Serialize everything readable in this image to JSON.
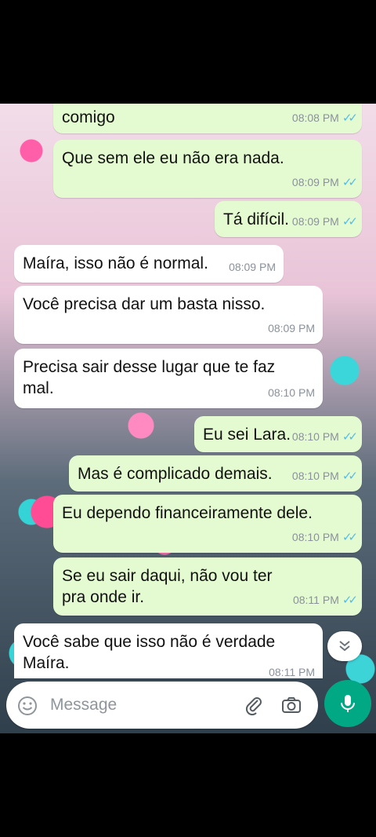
{
  "messages": [
    {
      "text": "comigo",
      "time": "08:08 PM",
      "direction": "out"
    },
    {
      "text": "Que sem ele eu não era nada.",
      "time": "08:09 PM",
      "direction": "out"
    },
    {
      "text": "Tá difícil.",
      "time": "08:09 PM",
      "direction": "out"
    },
    {
      "text": "Maíra, isso não é normal.",
      "time": "08:09 PM",
      "direction": "in"
    },
    {
      "text": "Você precisa dar um basta nisso.",
      "time": "08:09 PM",
      "direction": "in"
    },
    {
      "text": "Precisa sair desse lugar que te faz mal.",
      "time": "08:10 PM",
      "direction": "in"
    },
    {
      "text": "Eu sei Lara.",
      "time": "08:10 PM",
      "direction": "out"
    },
    {
      "text": "Mas é complicado demais.",
      "time": "08:10 PM",
      "direction": "out"
    },
    {
      "text": "Eu dependo financeiramente dele.",
      "time": "08:10 PM",
      "direction": "out"
    },
    {
      "text": "Se eu sair daqui, não vou ter pra onde ir.",
      "time": "08:11 PM",
      "direction": "out"
    },
    {
      "text": "Você sabe que isso não é verdade Maíra.",
      "time": "08:11 PM",
      "direction": "in"
    }
  ],
  "composer": {
    "placeholder": "Message"
  },
  "icons": {
    "emoji": "emoji-icon",
    "attach": "paperclip-icon",
    "camera": "camera-icon",
    "mic": "microphone-icon",
    "scroll": "chevron-double-down-icon"
  },
  "colors": {
    "outgoing": "#e4fbd1",
    "incoming": "#ffffff",
    "read_ticks": "#53bdeb",
    "accent": "#00a884"
  }
}
